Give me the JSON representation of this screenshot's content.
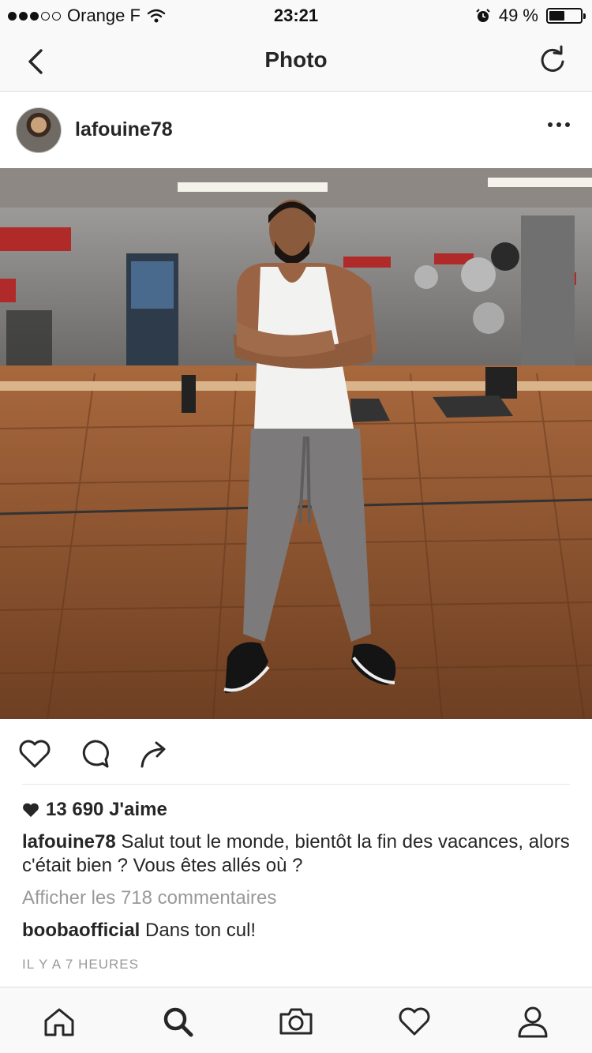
{
  "status_bar": {
    "carrier": "Orange F",
    "time": "23:21",
    "battery_percent_label": "49 %",
    "battery_level": 0.49,
    "icons": [
      "signal-dots-icon",
      "wifi-icon",
      "alarm-icon",
      "battery-icon"
    ]
  },
  "nav": {
    "title": "Photo",
    "back_icon": "chevron-left-icon",
    "refresh_icon": "refresh-icon"
  },
  "post": {
    "username": "lafouine78",
    "more_icon": "more-horizontal-icon",
    "photo_description_icon": "post-photo",
    "likes": "13 690 J'aime",
    "caption_user": "lafouine78",
    "caption_text": " Salut tout le monde, bientôt la fin des vacances, alors c'était bien ? Vous êtes allés où ?",
    "view_comments": "Afficher les 718 commentaires",
    "comment_user": "boobaofficial",
    "comment_text": " Dans ton cul!",
    "timestamp": "IL Y A 7 HEURES"
  },
  "actions": [
    "heart-icon",
    "comment-icon",
    "share-icon"
  ],
  "tab_bar": [
    "home-icon",
    "search-icon",
    "camera-icon",
    "activity-heart-icon",
    "profile-icon"
  ],
  "colors": {
    "text": "#262626",
    "muted": "#999999",
    "bar_background": "#f9f9f9",
    "border": "#dbdbdb"
  }
}
